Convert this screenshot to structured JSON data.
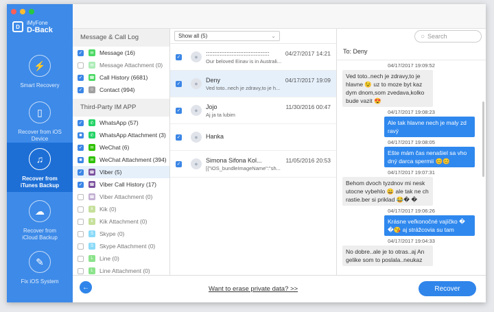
{
  "colors": {
    "primary": "#3d8ae8",
    "active_nav": "#1d6fd6",
    "traffic_red": "#fc5f57",
    "traffic_yellow": "#fdbc2e",
    "traffic_green": "#28c840"
  },
  "app": {
    "brand": "iMyFone",
    "product": "D-Back"
  },
  "nav": [
    {
      "label": "Smart Recovery",
      "icon": "smart-recovery-icon"
    },
    {
      "label": "Recover from iOS Device",
      "icon": "phone-icon"
    },
    {
      "label": "Recover from iTunes Backup",
      "icon": "music-note-icon",
      "active": true
    },
    {
      "label": "Recover from iCloud Backup",
      "icon": "cloud-icon"
    },
    {
      "label": "Fix iOS System",
      "icon": "wrench-icon"
    }
  ],
  "categories": {
    "section1": "Message & Call Log",
    "section2": "Third-Party IM APP",
    "items1": [
      {
        "label": "Message (16)",
        "checked": true
      },
      {
        "label": "Message Attachment (0)",
        "checked": false
      },
      {
        "label": "Call History (6681)",
        "checked": true
      },
      {
        "label": "Contact (994)",
        "checked": true
      }
    ],
    "items2": [
      {
        "label": "WhatsApp (57)",
        "checked": true
      },
      {
        "label": "WhatsApp Attachment (3)",
        "checked": true
      },
      {
        "label": "WeChat (6)",
        "checked": true
      },
      {
        "label": "WeChat Attachment (394)",
        "checked": true
      },
      {
        "label": "Viber (5)",
        "checked": true
      },
      {
        "label": "Viber Call History (17)",
        "checked": true
      },
      {
        "label": "Viber Attachment (0)",
        "checked": false
      },
      {
        "label": "Kik (0)",
        "checked": false
      },
      {
        "label": "Kik Attachment (0)",
        "checked": false
      },
      {
        "label": "Skype (0)",
        "checked": false
      },
      {
        "label": "Skype Attachment (0)",
        "checked": false
      },
      {
        "label": "Line (0)",
        "checked": false
      },
      {
        "label": "Line Attachment (0)",
        "checked": false
      }
    ]
  },
  "filter": {
    "label": "Show all (5)"
  },
  "search": {
    "placeholder": "Search"
  },
  "messages": [
    {
      "name": ":::::::::::::::::::::::::::::::::::::",
      "date": "04/27/2017 14:21",
      "preview": "Our beloved Einav is in Australi..."
    },
    {
      "name": "Deny",
      "date": "04/17/2017 19:09",
      "preview": "Ved toto..nech je zdravy,to je h..."
    },
    {
      "name": "Jojo",
      "date": "11/30/2016 00:47",
      "preview": "Aj ja ta lubim"
    },
    {
      "name": "Hanka",
      "date": "",
      "preview": ""
    },
    {
      "name": "Simona Sifona Kol...",
      "date": "11/05/2016 20:53",
      "preview": "[{\"iOS_bundleImageName\":\"sh..."
    }
  ],
  "conversation": {
    "to": "To:  Deny",
    "items": [
      {
        "ts": "04/17/2017 19:09:52",
        "dir": "in",
        "text": "Ved toto..nech je zdravy,to je hlavne 😉 uz to moze byt kaz dym dnom,som zvedava,kolko bude vazit 😍"
      },
      {
        "ts": "04/17/2017 19:08:23",
        "dir": "out",
        "text": "Ale tak hlavne nech je maly zd ravý"
      },
      {
        "ts": "04/17/2017 19:08:05",
        "dir": "out",
        "text": "Ešte mám čas nenašiel sa vho dný darca spermii 😊😊"
      },
      {
        "ts": "04/17/2017 19:07:31",
        "dir": "in",
        "text": "Behom dvoch tyzdnov mi nesk utocne vybehlo 😀 ale tak ne ch rastie.ber si priklad 😂� �"
      },
      {
        "ts": "04/17/2017 19:06:26",
        "dir": "out",
        "text": "Krásne veľkonočné vajíčko � �😘 aj strážcovia su tam"
      },
      {
        "ts": "04/17/2017 19:04:33",
        "dir": "in",
        "text": "No dobre..ale je to otras..aj An gelike som to poslala..neukaz"
      }
    ]
  },
  "bottom": {
    "erase_link": "Want to erase private data? >>",
    "recover": "Recover",
    "back": "←"
  }
}
